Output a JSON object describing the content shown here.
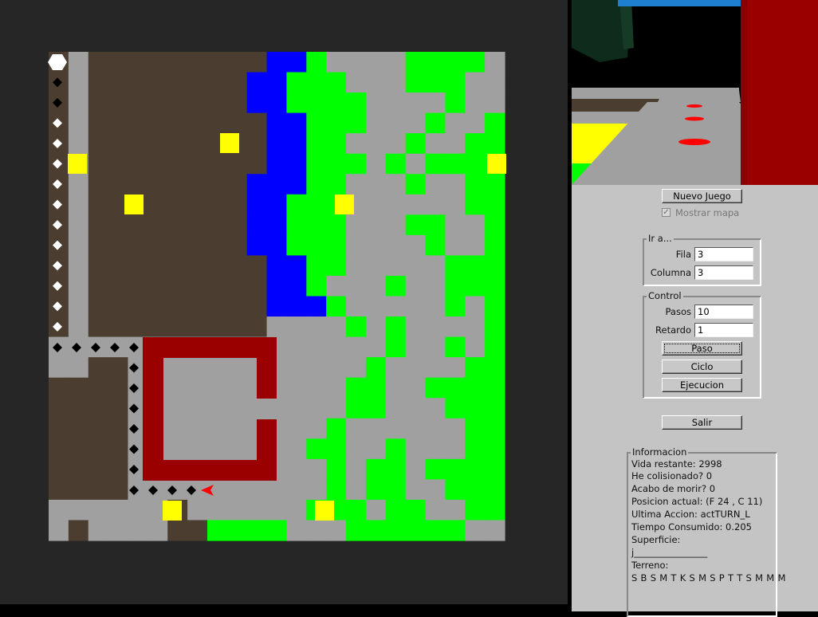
{
  "colors": {
    "background_panel": "#262626",
    "earth": "#4b3e30",
    "water": "#0000ff",
    "forest": "#00ff00",
    "stone": "#a0a0a0",
    "wall": "#9a0000",
    "item": "#ffff00",
    "agent": "#ff0000"
  },
  "map": {
    "legend_codes": "T=earth, A=water, B=forest, S=stone, M=wall, K=item"
  },
  "controls": {
    "new_game": "Nuevo Juego",
    "show_map": "Mostrar mapa",
    "show_map_checked": true,
    "goto_group": "Ir a...",
    "row_label": "Fila",
    "row_value": "3",
    "col_label": "Columna",
    "col_value": "3",
    "control_group": "Control",
    "steps_label": "Pasos",
    "steps_value": "10",
    "delay_label": "Retardo",
    "delay_value": "1",
    "step_button": "Paso",
    "cycle_button": "Ciclo",
    "run_button": "Ejecucion",
    "exit_button": "Salir"
  },
  "info": {
    "group": "Informacion",
    "lives": "Vida restante: 2998",
    "collided": "He colisionado? 0",
    "died": "Acabo de morir? 0",
    "position": "Posicion actual: (F 24 , C 11)",
    "last_action": "Ultima Accion: actTURN_L",
    "time": "Tiempo Consumido: 0.205",
    "surface_label": "Superficie:",
    "surface_value": "j________________",
    "terrain_label": "Terreno:",
    "terrain_value": "S B S M T K S M S P T T S M M M"
  }
}
